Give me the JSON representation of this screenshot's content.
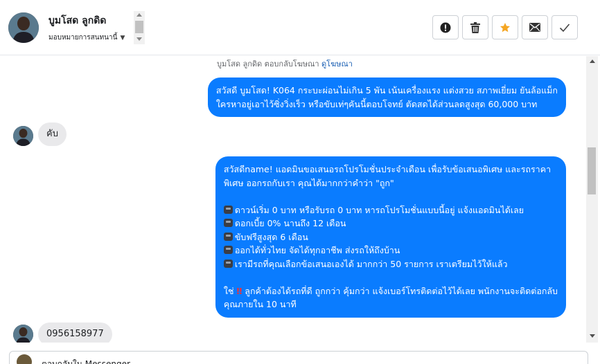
{
  "header": {
    "contact_name": "บูมโสด ลูกดิด",
    "assign_label": "มอบหมายการสนทนานี้",
    "icons": {
      "report": "exclamation-circle-icon",
      "delete": "trash-icon",
      "star": "star-icon",
      "mail": "envelope-icon",
      "done": "checkmark-icon"
    },
    "colors": {
      "star": "#f5a623"
    }
  },
  "chat": {
    "ad_reply_text": "บูมโสด ลูกดิด ตอบกลับโฆษณา",
    "ad_link": "ดูโฆษณา",
    "messages": [
      {
        "direction": "outgoing",
        "text": "สวัสดี บูมโสด! K064 กระบะผ่อนไม่เกิน 5 พัน เน้นเครื่องแรง แต่งสวย สภาพเยี่ยม ยันล้อแม็ก\nใครหาอยู่เอาไว้ซิ่งวิ่งเร็ว หรือขับเท่ๆคันนี้ตอบโจทย์ ตัดสดได้ส่วนลดสูงสุด 60,000 บาท"
      },
      {
        "direction": "incoming",
        "text": "คับ"
      },
      {
        "direction": "outgoing",
        "lines": [
          "สวัสดีname! แอดมินขอเสนอรถโปรโมชั่นประจำเดือน เพื่อรับข้อเสนอพิเศษ และรถราคา",
          "พิเศษ ออกรถกับเรา คุณได้มากกว่าคำว่า \"ถูก\"",
          "",
          "ดาวน์เริ่ม 0 บาท หรือรับรถ 0 บาท หารถโปรโมชั่นแบบนี้อยู่ แจ้งแอดมินได้เลย",
          "ดอกเบี้ย 0% นานถึง 12 เดือน",
          "ขับฟรีสูงสุด 6 เดือน",
          "ออกได้ทั่วไทย จัดได้ทุกอาชีพ ส่งรถให้ถึงบ้าน",
          "เรามีรถที่คุณเลือกข้อเสนอเองได้ มากกว่า 50 รายการ เราเตรียมไว้ให้แล้ว",
          "",
          "ใช่",
          "ลูกค้าต้องได้รถที่ดี ถูกกว่า คุ้มกว่า แจ้งเบอร์โทรติดต่อไว้ได้เลย พนักงานจะติดต่อกลับ",
          "คุณภายใน 10 นาที"
        ]
      },
      {
        "direction": "incoming",
        "text": "0956158977"
      }
    ],
    "bubble_color": "#0a7cff"
  },
  "composer": {
    "placeholder": "ตอบกลับใน Messenger"
  }
}
